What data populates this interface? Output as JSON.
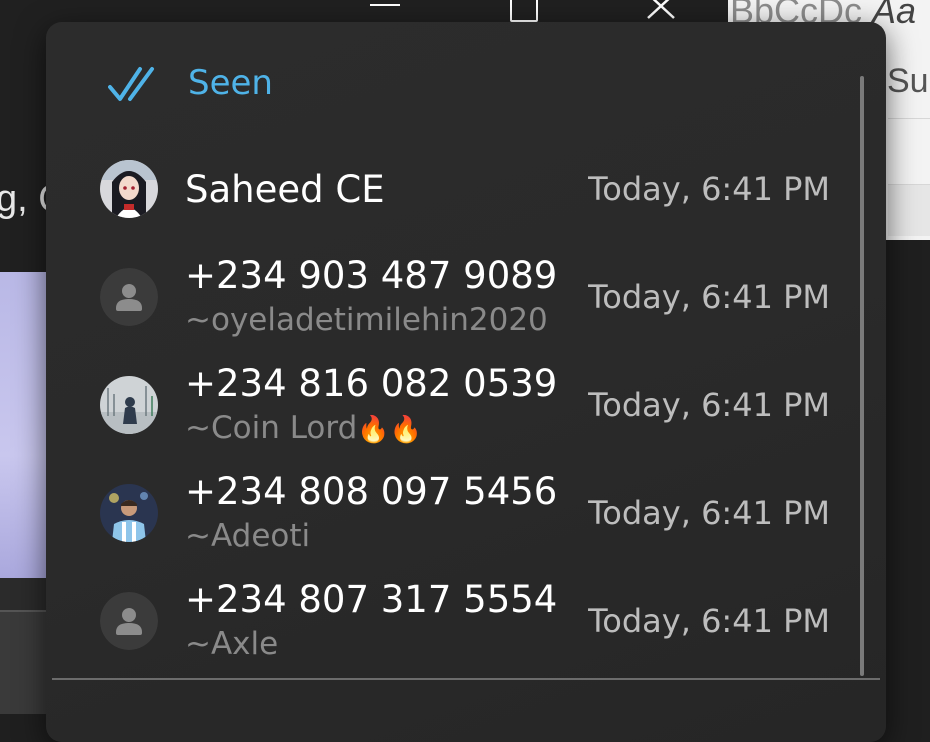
{
  "background": {
    "ribbon_text": "BbCcDc",
    "ribbon_italic": "Aa",
    "sub_label": "Sul",
    "left_text": "g, C"
  },
  "popup": {
    "seen_label": "Seen",
    "seen_icon": "double-check-icon",
    "accent_color": "#4fb3e8",
    "contacts": [
      {
        "name": "Saheed CE",
        "alias": "",
        "time": "Today, 6:41 PM",
        "avatar": "anime-avatar"
      },
      {
        "name": "+234 903 487 9089",
        "alias": "~oyeladetimilehin2020",
        "time": "Today, 6:41 PM",
        "avatar": "default-user-icon"
      },
      {
        "name": "+234 816 082 0539",
        "alias": "~Coin Lord",
        "alias_emoji": "🔥🔥",
        "time": "Today, 6:41 PM",
        "avatar": "photo-avatar"
      },
      {
        "name": "+234 808 097 5456",
        "alias": "~Adeoti",
        "time": "Today, 6:41 PM",
        "avatar": "photo-avatar"
      },
      {
        "name": "+234 807 317 5554",
        "alias": "~Axle",
        "time": "Today, 6:41 PM",
        "avatar": "default-user-icon"
      }
    ]
  }
}
